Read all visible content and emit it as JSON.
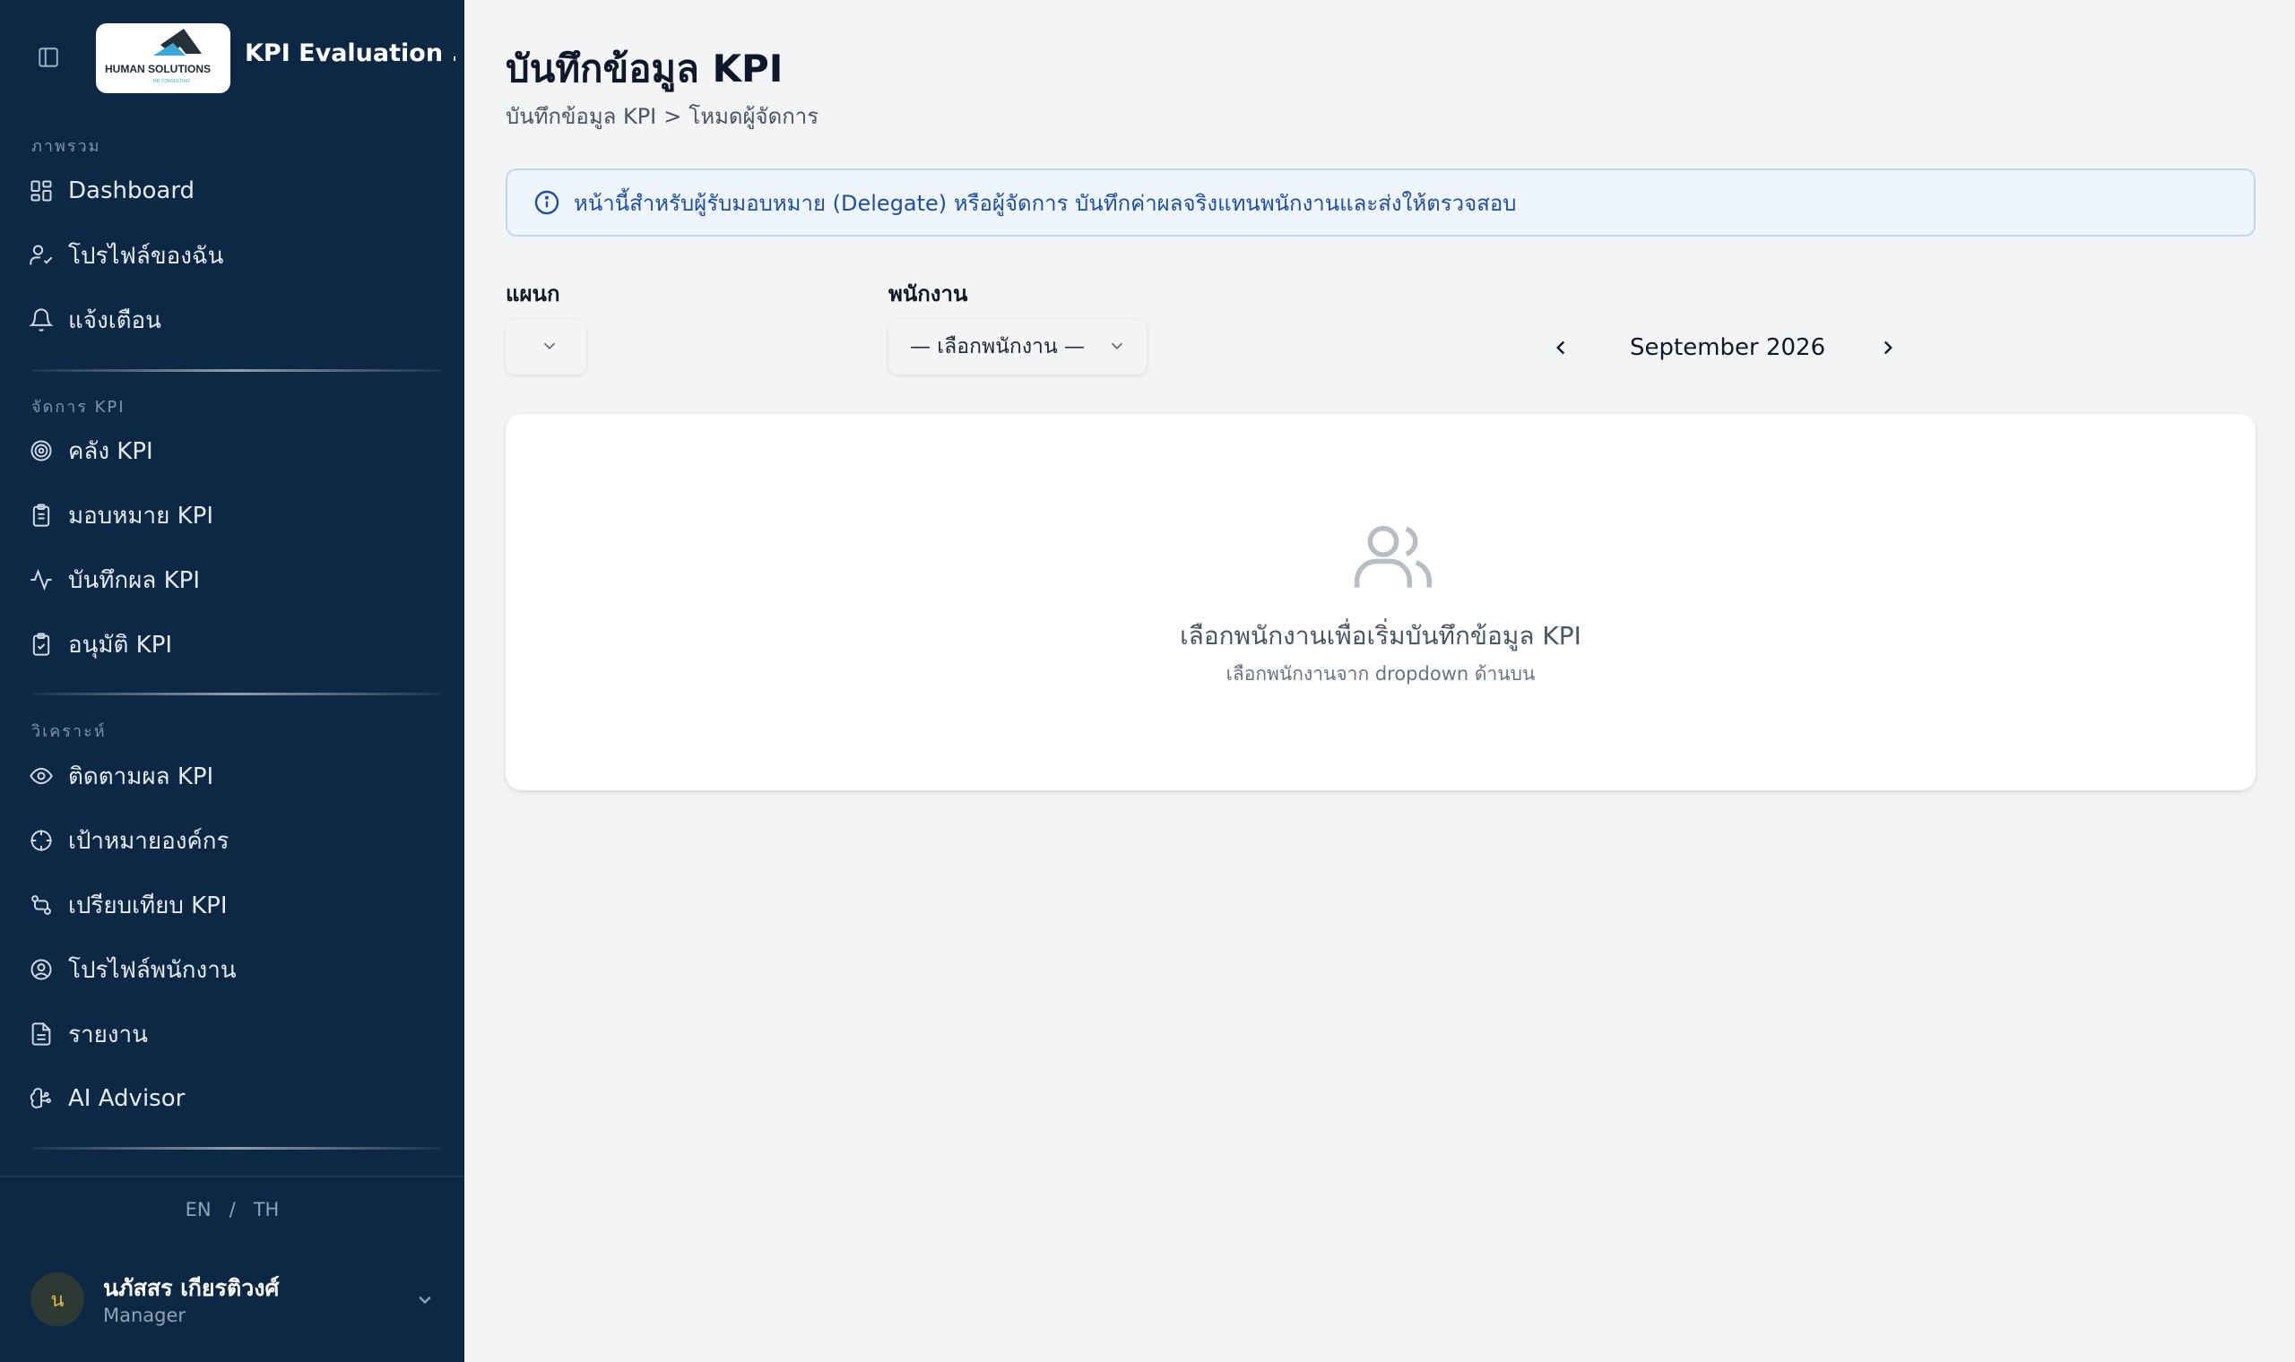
{
  "app": {
    "title": "KPI Evaluation ...",
    "logo_text": "HUMAN SOLUTIONS",
    "logo_subtext": "HR CONSULTING"
  },
  "sidebar": {
    "sections": [
      {
        "label": "ภาพรวม",
        "items": [
          {
            "label": "Dashboard",
            "icon": "dashboard-grid-icon"
          },
          {
            "label": "โปรไฟล์ของฉัน",
            "icon": "user-check-icon"
          },
          {
            "label": "แจ้งเตือน",
            "icon": "bell-icon"
          }
        ]
      },
      {
        "label": "จัดการ KPI",
        "items": [
          {
            "label": "คลัง KPI",
            "icon": "target-icon"
          },
          {
            "label": "มอบหมาย KPI",
            "icon": "clipboard-list-icon"
          },
          {
            "label": "บันทึกผล KPI",
            "icon": "activity-pulse-icon"
          },
          {
            "label": "อนุมัติ KPI",
            "icon": "clipboard-check-icon"
          }
        ]
      },
      {
        "label": "วิเคราะห์",
        "items": [
          {
            "label": "ติดตามผล KPI",
            "icon": "eye-icon"
          },
          {
            "label": "เป้าหมายองค์กร",
            "icon": "crosshair-icon"
          },
          {
            "label": "เปรียบเทียบ KPI",
            "icon": "compare-arrows-icon"
          },
          {
            "label": "โปรไฟล์พนักงาน",
            "icon": "user-circle-icon"
          },
          {
            "label": "รายงาน",
            "icon": "document-icon"
          },
          {
            "label": "AI Advisor",
            "icon": "brain-icon"
          }
        ]
      }
    ],
    "lang": {
      "en": "EN",
      "sep": "/",
      "th": "TH"
    },
    "user": {
      "initial": "น",
      "name": "นภัสสร เกียรติวงศ์",
      "role": "Manager"
    }
  },
  "page": {
    "title": "บันทึกข้อมูล KPI",
    "breadcrumb": {
      "parent": "บันทึกข้อมูล KPI",
      "sep": ">",
      "current": "โหมดผู้จัดการ"
    },
    "info_banner": "หน้านี้สำหรับผู้รับมอบหมาย (Delegate) หรือผู้จัดการ บันทึกค่าผลจริงแทนพนักงานและส่งให้ตรวจสอบ",
    "filters": {
      "department_label": "แผนก",
      "department_value": "",
      "employee_label": "พนักงาน",
      "employee_value": "— เลือกพนักงาน —"
    },
    "month": "September 2026",
    "empty_state": {
      "title": "เลือกพนักงานเพื่อเริ่มบันทึกข้อมูล KPI",
      "subtitle": "เลือกพนักงานจาก dropdown ด้านบน"
    }
  },
  "colors": {
    "sidebar_bg": "#0c2844",
    "main_bg": "#f3f4f6",
    "info_bg": "#eff5fd",
    "info_text": "#1e4fa8",
    "accent_logo": "#3aa8d8"
  }
}
